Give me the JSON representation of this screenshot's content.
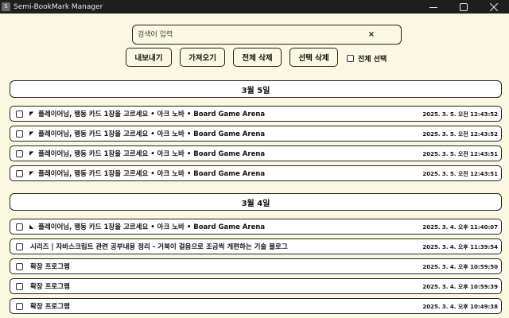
{
  "window": {
    "title": "Semi-BookMark Manager",
    "icon_label": "S"
  },
  "search": {
    "placeholder": "검색어 입력",
    "value": "",
    "clear_label": "×"
  },
  "toolbar": {
    "export_label": "내보내기",
    "import_label": "가져오기",
    "delete_all_label": "전체 삭제",
    "delete_selected_label": "선택 삭제",
    "select_all_label": "전체 선택",
    "select_all_checked": false
  },
  "groups": [
    {
      "date": "3월 5일",
      "items": [
        {
          "icon": "◤",
          "icon_name": "favicon-triangle-icon",
          "title": "플레이어님, 행동 카드 1장을 고르세요 • 아크 노바 • Board Game Arena",
          "time": "2025. 3. 5. 오전 12:43:52"
        },
        {
          "icon": "◤",
          "icon_name": "favicon-triangle-icon",
          "title": "플레이어님, 행동 카드 1장을 고르세요 • 아크 노바 • Board Game Arena",
          "time": "2025. 3. 5. 오전 12:43:52"
        },
        {
          "icon": "◤",
          "icon_name": "favicon-triangle-icon",
          "title": "플레이어님, 행동 카드 1장을 고르세요 • 아크 노바 • Board Game Arena",
          "time": "2025. 3. 5. 오전 12:43:51"
        },
        {
          "icon": "◤",
          "icon_name": "favicon-triangle-icon",
          "title": "플레이어님, 행동 카드 1장을 고르세요 • 아크 노바 • Board Game Arena",
          "time": "2025. 3. 5. 오전 12:43:51"
        }
      ]
    },
    {
      "date": "3월 4일",
      "items": [
        {
          "icon": "◣",
          "icon_name": "favicon-triangle-icon",
          "title": "플레이어님, 행동 카드 1장을 고르세요 • 아크 노바 • Board Game Arena",
          "time": "2025. 3. 4. 오후 11:40:07"
        },
        {
          "icon": "",
          "icon_name": "",
          "title": "시리즈 | 자바스크립트 관련 공부내용 정리 - 거북이 걸음으로 조금씩 개편하는 기술 블로그",
          "time": "2025. 3. 4. 오후 11:39:54"
        },
        {
          "icon": "",
          "icon_name": "",
          "title": "확장 프로그램",
          "time": "2025. 3. 4. 오후 10:59:50"
        },
        {
          "icon": "",
          "icon_name": "",
          "title": "확장 프로그램",
          "time": "2025. 3. 4. 오후 10:59:39"
        },
        {
          "icon": "",
          "icon_name": "",
          "title": "확장 프로그램",
          "time": "2025. 3. 4. 오후 10:49:38"
        }
      ]
    }
  ]
}
